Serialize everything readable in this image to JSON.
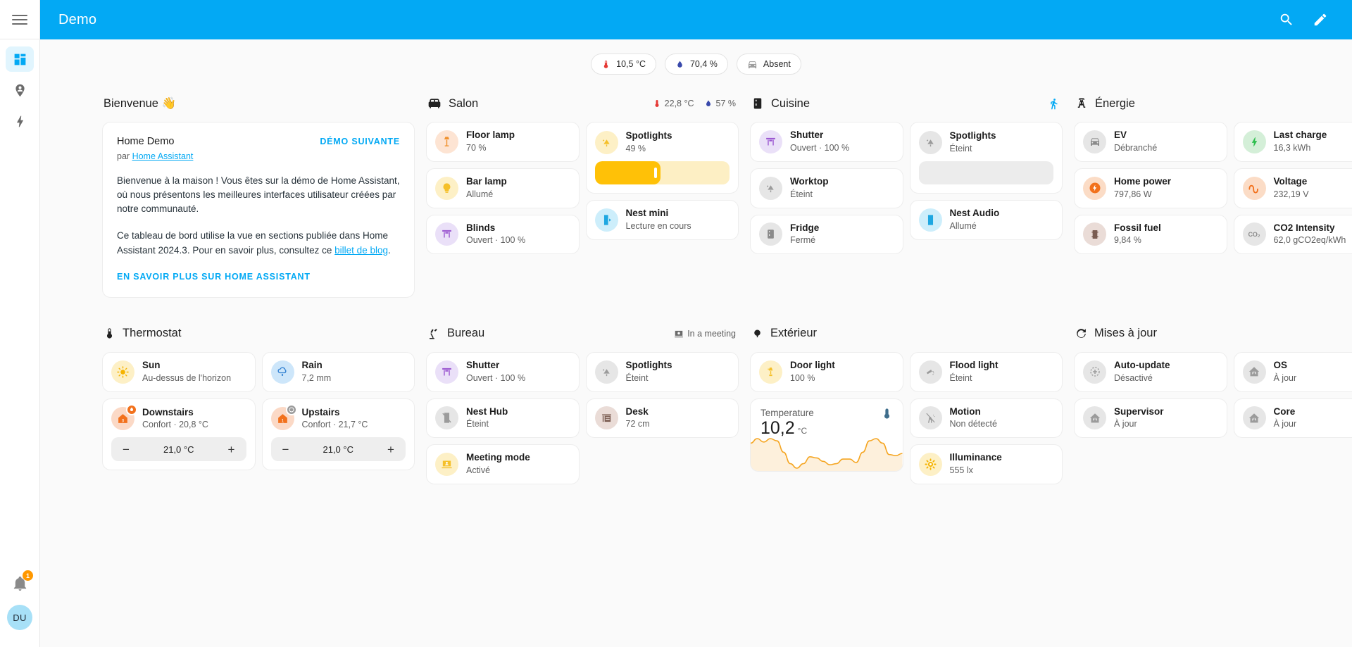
{
  "theme": {
    "brand": "#03A9F4",
    "amber": "#FFC107",
    "orange": "#FF9800"
  },
  "sidebar": {
    "items": [
      {
        "name": "dashboard",
        "icon": "view-dashboard-icon",
        "active": true
      },
      {
        "name": "map",
        "icon": "map-marker-account-icon",
        "active": false
      },
      {
        "name": "energy",
        "icon": "lightning-bolt-icon",
        "active": false
      }
    ],
    "notifications_count": "1",
    "avatar_initials": "DU"
  },
  "header": {
    "title": "Demo",
    "search_icon": "magnify-icon",
    "edit_icon": "pencil-icon"
  },
  "chips": [
    {
      "icon": "thermometer-icon",
      "label": "10,5 °C"
    },
    {
      "icon": "water-percent-icon",
      "label": "70,4 %"
    },
    {
      "icon": "car-icon",
      "label": "Absent"
    }
  ],
  "welcome": {
    "section_title": "Bienvenue 👋",
    "card_title": "Home Demo",
    "by_prefix": "par",
    "by_link": "Home Assistant",
    "next_demo": "DÉMO SUIVANTE",
    "paragraph1": "Bienvenue à la maison ! Vous êtes sur la démo de Home Assistant, où nous présentons les meilleures interfaces utilisateur créées par notre communauté.",
    "paragraph2_a": "Ce tableau de bord utilise la vue en sections publiée dans Home Assistant 2024.3. Pour en savoir plus, consultez ce ",
    "paragraph2_link": "billet de blog",
    "paragraph2_b": ".",
    "cta": "EN SAVOIR PLUS SUR HOME ASSISTANT"
  },
  "sections": {
    "salon": {
      "title": "Salon",
      "icon": "sofa-icon",
      "aux": [
        {
          "icon": "thermometer-icon",
          "label": "22,8 °C"
        },
        {
          "icon": "water-percent-icon",
          "label": "57 %"
        }
      ],
      "tiles": {
        "floor_lamp": {
          "name": "Floor lamp",
          "state": "70 %"
        },
        "bar_lamp": {
          "name": "Bar lamp",
          "state": "Allumé"
        },
        "blinds": {
          "name": "Blinds",
          "state": "Ouvert · 100 %"
        },
        "spotlights": {
          "name": "Spotlights",
          "state": "49 %",
          "slider_percent": 49
        },
        "nest_mini": {
          "name": "Nest mini",
          "state": "Lecture en cours"
        }
      }
    },
    "cuisine": {
      "title": "Cuisine",
      "icon": "fridge-icon",
      "aux_icon": "motion-sensor-icon",
      "tiles": {
        "shutter": {
          "name": "Shutter",
          "state": "Ouvert · 100 %"
        },
        "worktop": {
          "name": "Worktop",
          "state": "Éteint"
        },
        "fridge": {
          "name": "Fridge",
          "state": "Fermé"
        },
        "spotlights": {
          "name": "Spotlights",
          "state": "Éteint",
          "slider_percent": 0
        },
        "nest_audio": {
          "name": "Nest Audio",
          "state": "Allumé"
        }
      }
    },
    "energie": {
      "title": "Énergie",
      "icon": "transmission-tower-icon",
      "tiles": {
        "ev": {
          "name": "EV",
          "state": "Débranché"
        },
        "home_power": {
          "name": "Home power",
          "state": "797,86 W"
        },
        "fossil_fuel": {
          "name": "Fossil fuel",
          "state": "9,84 %"
        },
        "last_charge": {
          "name": "Last charge",
          "state": "16,3 kWh"
        },
        "voltage": {
          "name": "Voltage",
          "state": "232,19 V"
        },
        "co2": {
          "name": "CO2 Intensity",
          "state": "62,0 gCO2eq/kWh"
        }
      }
    },
    "thermostat": {
      "title": "Thermostat",
      "icon": "thermometer-icon",
      "tiles": {
        "sun": {
          "name": "Sun",
          "state": "Au-dessus de l'horizon"
        },
        "rain": {
          "name": "Rain",
          "state": "7,2 mm"
        },
        "downstairs": {
          "name": "Downstairs",
          "state": "Confort · 20,8 °C",
          "target": "21,0 °C",
          "minus": "−",
          "plus": "+"
        },
        "upstairs": {
          "name": "Upstairs",
          "state": "Confort · 21,7 °C",
          "target": "21,0 °C",
          "minus": "−",
          "plus": "+"
        }
      }
    },
    "bureau": {
      "title": "Bureau",
      "icon": "desk-lamp-icon",
      "aux": [
        {
          "icon": "webcam-icon",
          "label": "In a meeting"
        }
      ],
      "tiles": {
        "shutter": {
          "name": "Shutter",
          "state": "Ouvert · 100 %"
        },
        "nest_hub": {
          "name": "Nest Hub",
          "state": "Éteint"
        },
        "meeting_mode": {
          "name": "Meeting mode",
          "state": "Activé"
        },
        "spotlights": {
          "name": "Spotlights",
          "state": "Éteint"
        },
        "desk": {
          "name": "Desk",
          "state": "72 cm"
        }
      }
    },
    "exterieur": {
      "title": "Extérieur",
      "icon": "tree-icon",
      "tiles": {
        "door_light": {
          "name": "Door light",
          "state": "100 %"
        },
        "flood_light": {
          "name": "Flood light",
          "state": "Éteint"
        },
        "motion": {
          "name": "Motion",
          "state": "Non détecté"
        },
        "illuminance": {
          "name": "Illuminance",
          "state": "555 lx"
        }
      },
      "temperature_card": {
        "label": "Temperature",
        "value": "10,2",
        "unit": "°C",
        "icon": "thermometer-icon"
      }
    },
    "updates": {
      "title": "Mises à jour",
      "icon": "update-icon",
      "tiles": {
        "auto_update": {
          "name": "Auto-update",
          "state": "Désactivé"
        },
        "os": {
          "name": "OS",
          "state": "À jour"
        },
        "supervisor": {
          "name": "Supervisor",
          "state": "À jour"
        },
        "core": {
          "name": "Core",
          "state": "À jour"
        }
      }
    }
  },
  "chart_data": {
    "type": "area",
    "title": "Temperature",
    "ylabel": "°C",
    "current_value": 10.2,
    "x": [
      0,
      1,
      2,
      3,
      4,
      5,
      6,
      7,
      8,
      9,
      10,
      11,
      12,
      13,
      14,
      15,
      16,
      17,
      18,
      19,
      20,
      21,
      22,
      23
    ],
    "values": [
      11.2,
      11.6,
      11.3,
      11.6,
      11.4,
      10.4,
      9.4,
      9.0,
      9.4,
      10.0,
      9.9,
      9.6,
      9.3,
      9.4,
      9.8,
      9.8,
      9.5,
      10.4,
      11.4,
      11.6,
      11.2,
      10.2,
      10.1,
      10.3
    ],
    "line_color": "#F5A623",
    "fill_color": "#FDF0DC",
    "grid": false,
    "legend": false
  }
}
